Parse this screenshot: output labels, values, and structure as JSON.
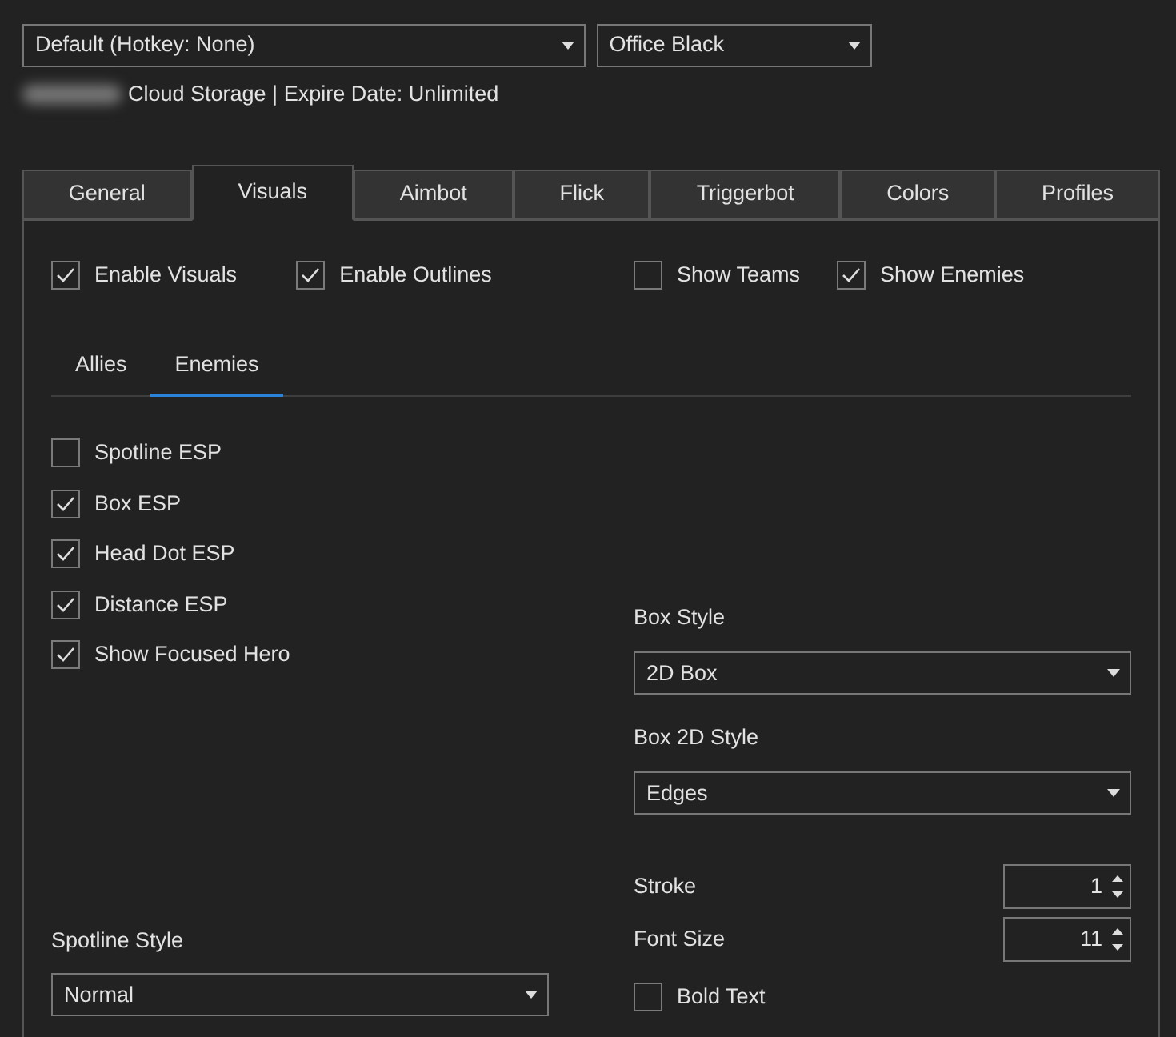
{
  "profile_select": {
    "value": "Default (Hotkey: None)"
  },
  "theme_select": {
    "value": "Office Black"
  },
  "status_text": "Cloud Storage | Expire Date: Unlimited",
  "tabs": [
    {
      "label": "General",
      "selected": false
    },
    {
      "label": "Visuals",
      "selected": true
    },
    {
      "label": "Aimbot",
      "selected": false
    },
    {
      "label": "Flick",
      "selected": false
    },
    {
      "label": "Triggerbot",
      "selected": false
    },
    {
      "label": "Colors",
      "selected": false
    },
    {
      "label": "Profiles",
      "selected": false
    }
  ],
  "top_options": [
    {
      "label": "Enable Visuals",
      "checked": true
    },
    {
      "label": "Enable Outlines",
      "checked": true
    },
    {
      "label": "Show Teams",
      "checked": false
    },
    {
      "label": "Show Enemies",
      "checked": true
    }
  ],
  "sub_tabs": [
    {
      "label": "Allies",
      "selected": false
    },
    {
      "label": "Enemies",
      "selected": true
    }
  ],
  "esp_options": [
    {
      "label": "Spotline ESP",
      "checked": false
    },
    {
      "label": "Box ESP",
      "checked": true
    },
    {
      "label": "Head Dot ESP",
      "checked": true
    },
    {
      "label": "Distance ESP",
      "checked": true
    },
    {
      "label": "Show Focused Hero",
      "checked": true
    }
  ],
  "box_style": {
    "label": "Box Style",
    "value": "2D Box"
  },
  "box_2d_style": {
    "label": "Box 2D Style",
    "value": "Edges"
  },
  "stroke": {
    "label": "Stroke",
    "value": "1"
  },
  "font_size": {
    "label": "Font Size",
    "value": "11"
  },
  "bold_text": {
    "label": "Bold Text",
    "checked": false
  },
  "spotline_style": {
    "label": "Spotline Style",
    "value": "Normal"
  }
}
